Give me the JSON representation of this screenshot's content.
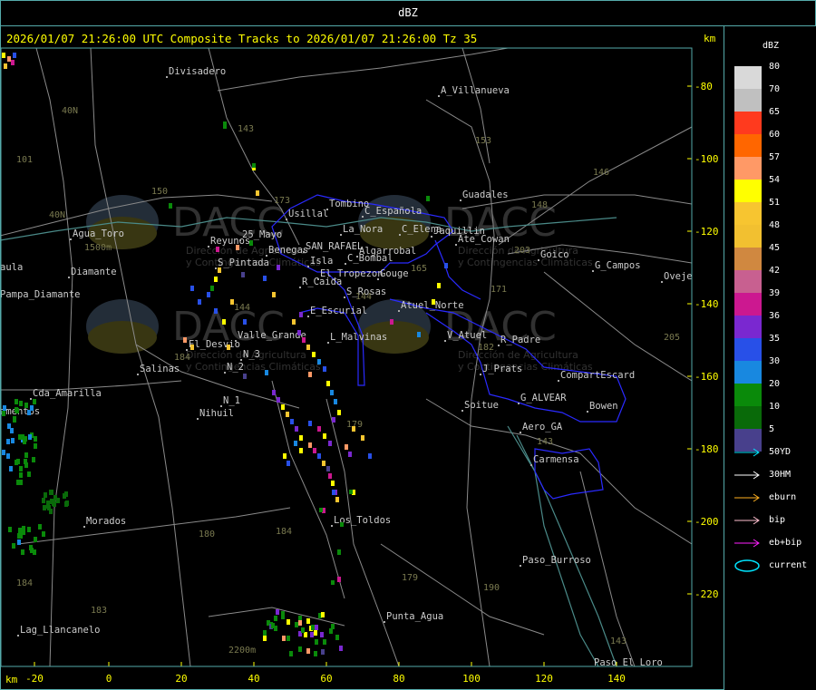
{
  "header": {
    "title": "dBZ"
  },
  "map": {
    "title": "2026/01/07 21:26:00 UTC Composite Tracks to 2026/01/07 21:26:00 Tz 35",
    "unit_top": "km",
    "unit_bottom": "km",
    "x_ticks": [
      "-20",
      "0",
      "20",
      "40",
      "60",
      "80",
      "100",
      "120",
      "140"
    ],
    "y_ticks": [
      "-80",
      "-100",
      "-120",
      "-140",
      "-160",
      "-180",
      "-200",
      "-220"
    ],
    "watermark_text": "DACC",
    "watermark_sub_1": "Dirección de Agricultura",
    "watermark_sub_2": "y Contingencias Climáticas",
    "places": [
      {
        "t": "Divisadero"
      },
      {
        "t": "A_Villanueva"
      },
      {
        "t": "Guadales"
      },
      {
        "t": "Tombino"
      },
      {
        "t": "Usillal"
      },
      {
        "t": "C_Española"
      },
      {
        "t": "La_Nora"
      },
      {
        "t": "C_Elena"
      },
      {
        "t": "Jaquillin"
      },
      {
        "t": "Ate_Cowan"
      },
      {
        "t": "Goico"
      },
      {
        "t": "G_Campos"
      },
      {
        "t": "Oveje"
      },
      {
        "t": "Agua_Toro"
      },
      {
        "t": "Diamante"
      },
      {
        "t": "aula"
      },
      {
        "t": "Pampa_Diamante"
      },
      {
        "t": "Reyunos"
      },
      {
        "t": "25_Mayo"
      },
      {
        "t": "Benegas"
      },
      {
        "t": "SAN_RAFAEL"
      },
      {
        "t": "Algarrobal"
      },
      {
        "t": "C_Bombal"
      },
      {
        "t": "S_Pintada"
      },
      {
        "t": "Isla"
      },
      {
        "t": "El_Tropezon"
      },
      {
        "t": "Gouge"
      },
      {
        "t": "R_Caida"
      },
      {
        "t": "S_Rosas"
      },
      {
        "t": "Atuel_Norte"
      },
      {
        "t": "E_Escurial"
      },
      {
        "t": "Valle_Grande"
      },
      {
        "t": "L_Malvinas"
      },
      {
        "t": "V_Atuel"
      },
      {
        "t": "R_Padre"
      },
      {
        "t": "El_Desvio"
      },
      {
        "t": "Salinas"
      },
      {
        "t": "N_2"
      },
      {
        "t": "N_3"
      },
      {
        "t": "J_Prats"
      },
      {
        "t": "CompartEscard"
      },
      {
        "t": "Cda_Amarilla"
      },
      {
        "t": "N_1"
      },
      {
        "t": "Nihuil"
      },
      {
        "t": "G_ALVEAR"
      },
      {
        "t": "Bowen"
      },
      {
        "t": "Soitue"
      },
      {
        "t": "Aero_GA"
      },
      {
        "t": "amentos"
      },
      {
        "t": "Carmensa"
      },
      {
        "t": "Morados"
      },
      {
        "t": "Los_Toldos"
      },
      {
        "t": "Paso_Burroso"
      },
      {
        "t": "Punta_Agua"
      },
      {
        "t": "Lag_Llancanelo"
      },
      {
        "t": "Paso_El_Loro"
      }
    ],
    "route_labels": [
      "40N",
      "101",
      "143",
      "153",
      "146",
      "150",
      "148",
      "40N",
      "203",
      "171",
      "144",
      "165",
      "184",
      "179",
      "180",
      "184",
      "184",
      "179",
      "190",
      "183",
      "143",
      "205",
      "143",
      "2200m",
      "1500m",
      "173",
      "144",
      "182"
    ]
  },
  "legend": {
    "title": "dBZ",
    "scale": [
      {
        "label": "80",
        "color": "#d9d9d9"
      },
      {
        "label": "70",
        "color": "#c0c0c0"
      },
      {
        "label": "65",
        "color": "#ff3a1e"
      },
      {
        "label": "60",
        "color": "#ff6600"
      },
      {
        "label": "57",
        "color": "#ff9966"
      },
      {
        "label": "54",
        "color": "#ffff00"
      },
      {
        "label": "51",
        "color": "#f7c530"
      },
      {
        "label": "48",
        "color": "#f2c030"
      },
      {
        "label": "45",
        "color": "#d08840"
      },
      {
        "label": "42",
        "color": "#c86090"
      },
      {
        "label": "39",
        "color": "#cc1890"
      },
      {
        "label": "36",
        "color": "#7a28d0"
      },
      {
        "label": "35",
        "color": "#2850e8"
      },
      {
        "label": "30",
        "color": "#1888e0"
      },
      {
        "label": "20",
        "color": "#0a8a0a"
      },
      {
        "label": "10",
        "color": "#096a09"
      },
      {
        "label": "5",
        "color": "#48408c"
      }
    ],
    "tracks": [
      {
        "label": "50YD",
        "color": "#00e5ff"
      },
      {
        "label": "30HM",
        "color": "#ffffff"
      },
      {
        "label": "eburn",
        "color": "#ffb020"
      },
      {
        "label": "bip",
        "color": "#ffc0d0"
      },
      {
        "label": "eb+bip",
        "color": "#ff20ff"
      },
      {
        "label": "current",
        "color": "#00e5ff"
      }
    ]
  }
}
